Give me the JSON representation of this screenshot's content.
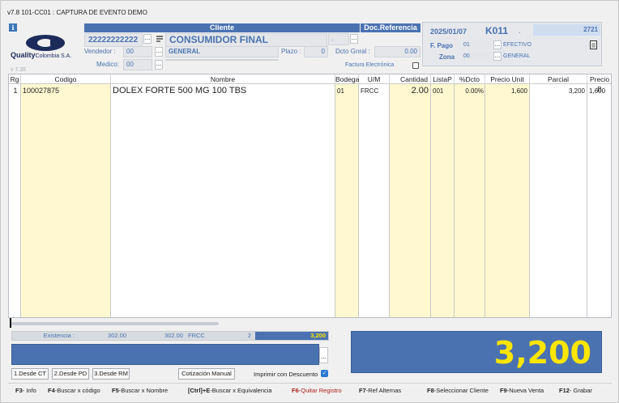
{
  "window": {
    "title": "v7.8 101-CC01 : CAPTURA DE EVENTO DEMO"
  },
  "logo": {
    "company": "Quality",
    "company_suffix": "Colombia S.A.",
    "version": "v 7.35"
  },
  "client": {
    "header": "Cliente",
    "id": "22222222222",
    "name": "CONSUMIDOR FINAL",
    "vendor_label": "Vendedor :",
    "vendor_code": "00",
    "vendor_name": "GENERAL",
    "medic_label": "Medico:",
    "medic_code": "00",
    "plazo_label": "Plazo :",
    "plazo_value": "0",
    "dcto_label": "Dcto Gnral :",
    "dcto_value": "0.00",
    "factura_label": "Factura Electrónica"
  },
  "doc_ref": {
    "header": "Doc.Referencia",
    "value": "."
  },
  "doc": {
    "date": "2025/01/07",
    "code": "K011",
    "suffix": ".",
    "number": "2721",
    "fpago_label": "F. Pago",
    "fpago_code": "01",
    "fpago_name": "EFECTIVO",
    "zona_label": "Zona",
    "zona_code": "00",
    "zona_name": "GENERAL"
  },
  "grid": {
    "headers": [
      "Rg",
      "Codigo",
      "Nombre",
      "Bodega",
      "U/M",
      "Cantidad",
      "ListaP",
      "%Dcto",
      "Precio Unit",
      "Parcial",
      "Precio B"
    ],
    "rows": [
      {
        "rg": "1",
        "codigo": "100027875",
        "nombre": "DOLEX FORTE 500 MG 100 TBS",
        "bodega": "01",
        "um": "FRCC",
        "cantidad": "2.00",
        "listap": "001",
        "dcto": "0.00%",
        "precio_unit": "1,600",
        "parcial": "3,200",
        "precio_b": "1,600"
      }
    ]
  },
  "summary": {
    "existencia_label": "Existencia :",
    "existencia": "302.00",
    "existencia2": "302.00",
    "um": "FRCC",
    "count": "2",
    "total": "3,200"
  },
  "total_display": "3,200",
  "buttons": {
    "desde_ct": "1.Desde CT",
    "desde_pd": "2.Desde PD",
    "desde_rm": "3.Desde RM",
    "cotizacion": "Cotización Manual",
    "imprimir": "Imprimir con Descuento"
  },
  "fkeys": [
    {
      "key": "F3",
      "label": "- Info"
    },
    {
      "key": "F4",
      "label": "-Buscar x código"
    },
    {
      "key": "F5",
      "label": "-Buscar x Nombre"
    },
    {
      "key": "[Ctrl]+E",
      "label": "-Buscar x Equivalencia"
    },
    {
      "key": "F6",
      "label": "-Quitar Registro"
    },
    {
      "key": "F7",
      "label": "-Ref Alternas"
    },
    {
      "key": "F8",
      "label": "-Seleccionar Cliente"
    },
    {
      "key": "F9",
      "label": "-Nueva Venta"
    },
    {
      "key": "F12",
      "label": "- Grabar"
    }
  ],
  "colors": {
    "accent": "#4a72b0",
    "highlight": "#ffe600",
    "grid_yellow": "#fff8d0"
  }
}
